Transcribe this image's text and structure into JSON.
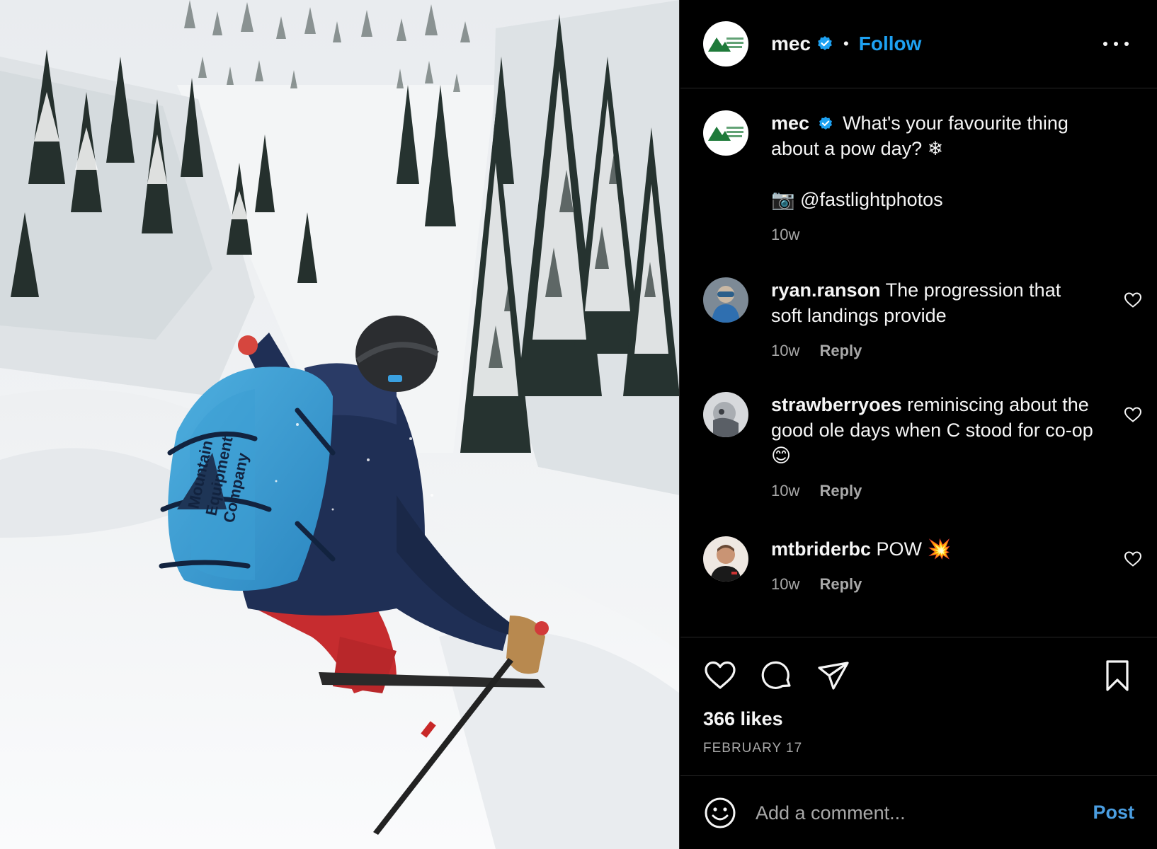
{
  "post": {
    "username": "mec",
    "verified": true,
    "follow_label": "Follow",
    "avatar_alt": "Mountain Equipment Company",
    "photo_subject": "Skier with blue Mountain Equipment Company backpack descending snowy forest chute",
    "backpack_text": [
      "Mountain",
      "Equipment",
      "Company"
    ]
  },
  "caption": {
    "username": "mec",
    "text": "What's your favourite thing about a pow day? ❄",
    "credit": "📷 @fastlightphotos",
    "time": "10w"
  },
  "comments": [
    {
      "username": "ryan.ranson",
      "text": "The progression that soft landings provide",
      "time": "10w",
      "reply_label": "Reply"
    },
    {
      "username": "strawberryoes",
      "text": "reminiscing about the good ole days when C stood for co-op 😊",
      "time": "10w",
      "reply_label": "Reply"
    },
    {
      "username": "mtbriderbc",
      "text": "POW 💥",
      "time": "10w",
      "reply_label": "Reply"
    }
  ],
  "stats": {
    "likes": "366 likes",
    "date": "FEBRUARY 17"
  },
  "composer": {
    "placeholder": "Add a comment...",
    "post_label": "Post"
  },
  "icons": {
    "like": "heart-icon",
    "comment": "comment-icon",
    "share": "share-icon",
    "save": "bookmark-icon",
    "emoji": "emoji-icon",
    "more": "more-icon"
  },
  "colors": {
    "background": "#000000",
    "follow": "#1da1f2",
    "muted": "#a8a8a8",
    "divider": "#262626",
    "post_button": "#4a9de0"
  }
}
